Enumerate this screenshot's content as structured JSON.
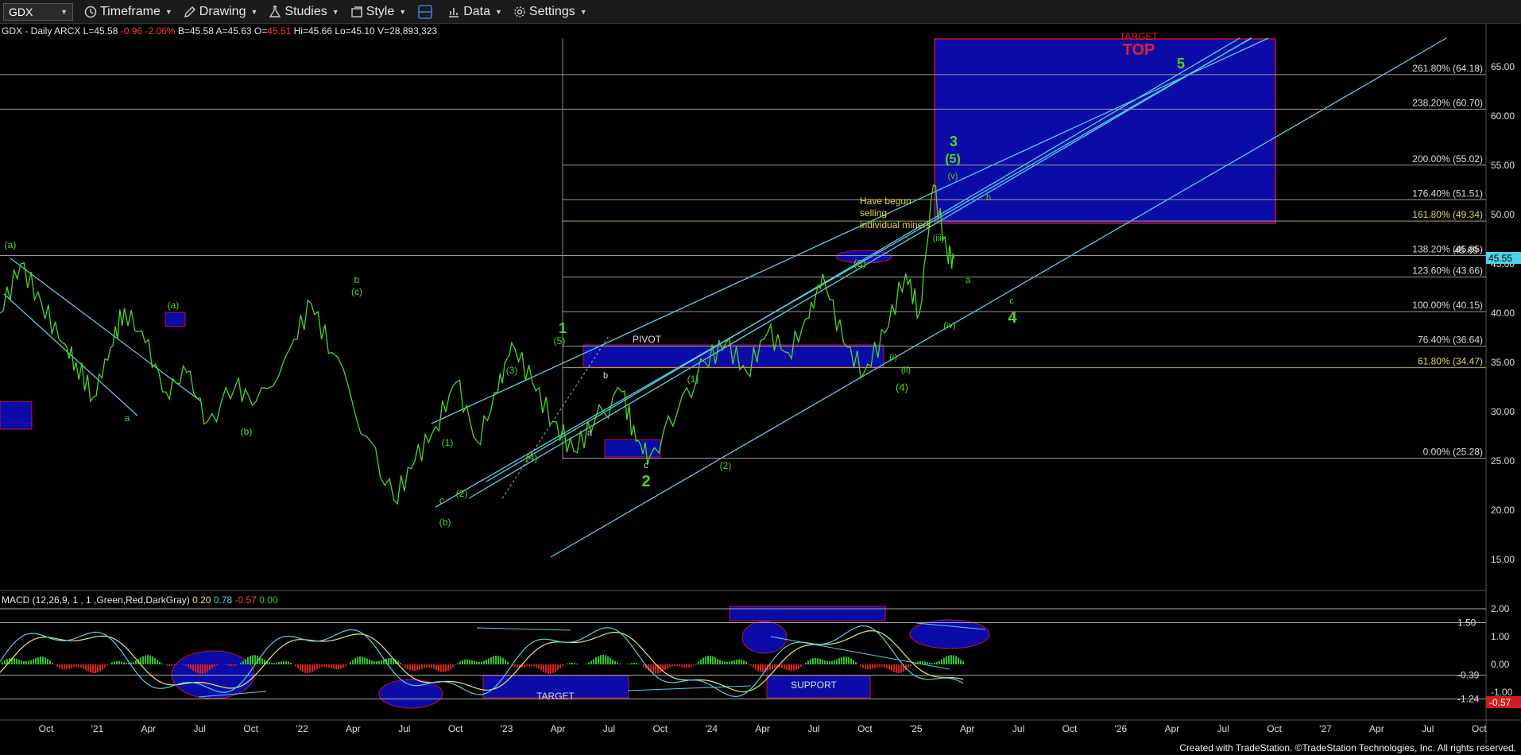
{
  "toolbar": {
    "symbol": "GDX",
    "timeframe": "Timeframe",
    "drawing": "Drawing",
    "studies": "Studies",
    "style": "Style",
    "data": "Data",
    "settings": "Settings"
  },
  "info": {
    "header": "GDX - Daily  ARCX  L=45.58",
    "chg": "-0.96",
    "pct": "-2.06%",
    "mid": "B=45.58  A=45.63  O=",
    "open": "45.51",
    "rest": "Hi=45.66  Lo=45.10  V=28,893,323"
  },
  "macd": {
    "label": "MACD (12,26,9, 1 , 1 ,Green,Red,DarkGray)",
    "v1": "0.20",
    "v2": "0.78",
    "v3": "-0.57",
    "v4": "0.00"
  },
  "footer": "Created with TradeStation. ©TradeStation Technologies, Inc. All rights reserved.",
  "chart_data": {
    "type": "line",
    "title": "GDX - Daily",
    "y_axis": [
      "65.00",
      "60.00",
      "55.00",
      "50.00",
      "45.00",
      "40.00",
      "35.00",
      "30.00",
      "25.00",
      "20.00",
      "15.00"
    ],
    "macd_axis": [
      "2.00",
      "1.00",
      "0.00",
      "-1.00"
    ],
    "macd_levels": [
      "1.50",
      "-0.39",
      "-1.24"
    ],
    "macd_last": "-0.57",
    "last_price": "45.55",
    "prev_tag": "45.69",
    "x_axis": [
      "Oct",
      "'21",
      "Apr",
      "Jul",
      "Oct",
      "'22",
      "Apr",
      "Jul",
      "Oct",
      "'23",
      "Apr",
      "Jul",
      "Oct",
      "'24",
      "Apr",
      "Jul",
      "Oct",
      "'25",
      "Apr",
      "Jul",
      "Oct",
      "'26",
      "Apr",
      "Jul",
      "Oct",
      "'27",
      "Apr",
      "Jul",
      "Oct"
    ],
    "fib_levels": [
      {
        "label": "261.80% (64.18)",
        "value": 64.2
      },
      {
        "label": "238.20% (60.70)",
        "value": 60.7
      },
      {
        "label": "200.00% (55.02)",
        "value": 55.02
      },
      {
        "label": "176.40% (51.51)",
        "value": 51.51
      },
      {
        "label": "161.80% (49.34)",
        "value": 49.34
      },
      {
        "label": "138.20% (45.85)",
        "value": 45.85
      },
      {
        "label": "123.60% (43.66)",
        "value": 43.66
      },
      {
        "label": "100.00% (40.15)",
        "value": 40.15
      },
      {
        "label": "76.40% (36.64)",
        "value": 36.64
      },
      {
        "label": "61.80% (34.47)",
        "value": 34.47
      },
      {
        "label": "0.00% (25.28)",
        "value": 25.28
      }
    ],
    "price_points": [
      [
        0,
        40
      ],
      [
        0.3,
        45
      ],
      [
        0.6,
        41
      ],
      [
        0.9,
        37
      ],
      [
        1.1,
        35
      ],
      [
        1.35,
        31.5
      ],
      [
        1.6,
        36.5
      ],
      [
        1.8,
        40.5
      ],
      [
        2.1,
        37
      ],
      [
        2.4,
        32
      ],
      [
        2.7,
        34
      ],
      [
        3.0,
        29
      ],
      [
        3.4,
        32.5
      ],
      [
        3.7,
        31
      ],
      [
        4.2,
        36.5
      ],
      [
        4.5,
        41
      ],
      [
        4.8,
        36
      ],
      [
        5.3,
        27.5
      ],
      [
        5.7,
        21
      ],
      [
        6.0,
        25
      ],
      [
        6.3,
        28.5
      ],
      [
        6.6,
        33
      ],
      [
        6.9,
        27
      ],
      [
        7.2,
        32
      ],
      [
        7.4,
        37
      ],
      [
        7.7,
        33
      ],
      [
        8.0,
        29
      ],
      [
        8.3,
        26
      ],
      [
        8.6,
        29
      ],
      [
        9.0,
        32
      ],
      [
        9.2,
        27
      ],
      [
        9.4,
        25.5
      ],
      [
        9.8,
        30
      ],
      [
        10.2,
        35
      ],
      [
        10.5,
        37
      ],
      [
        10.8,
        34
      ],
      [
        11.1,
        38
      ],
      [
        11.4,
        36
      ],
      [
        11.7,
        39.5
      ],
      [
        11.9,
        44
      ],
      [
        12.2,
        37
      ],
      [
        12.5,
        34
      ],
      [
        12.8,
        38
      ],
      [
        13.1,
        44
      ],
      [
        13.3,
        40
      ],
      [
        13.5,
        53
      ],
      [
        13.7,
        46
      ],
      [
        13.8,
        45.55
      ]
    ],
    "annotations": [
      "(a)",
      "a",
      "(a)",
      "(b)",
      "b",
      "(c)",
      "(b)",
      "c",
      "(1)",
      "(2)",
      "(3)",
      "(4)",
      "(5)",
      "1",
      "PIVOT",
      "a",
      "b",
      "c",
      "2",
      "(1)",
      "(2)",
      "(3)",
      "(4)",
      "(i)",
      "(ii)",
      "(iii)",
      "(iv)",
      "(v)",
      "(5)",
      "3",
      "a",
      "b",
      "c",
      "4",
      "5",
      "TARGET",
      "TOP",
      "Have begun",
      "selling",
      "individual miners",
      "TARGET",
      "SUPPORT"
    ]
  }
}
